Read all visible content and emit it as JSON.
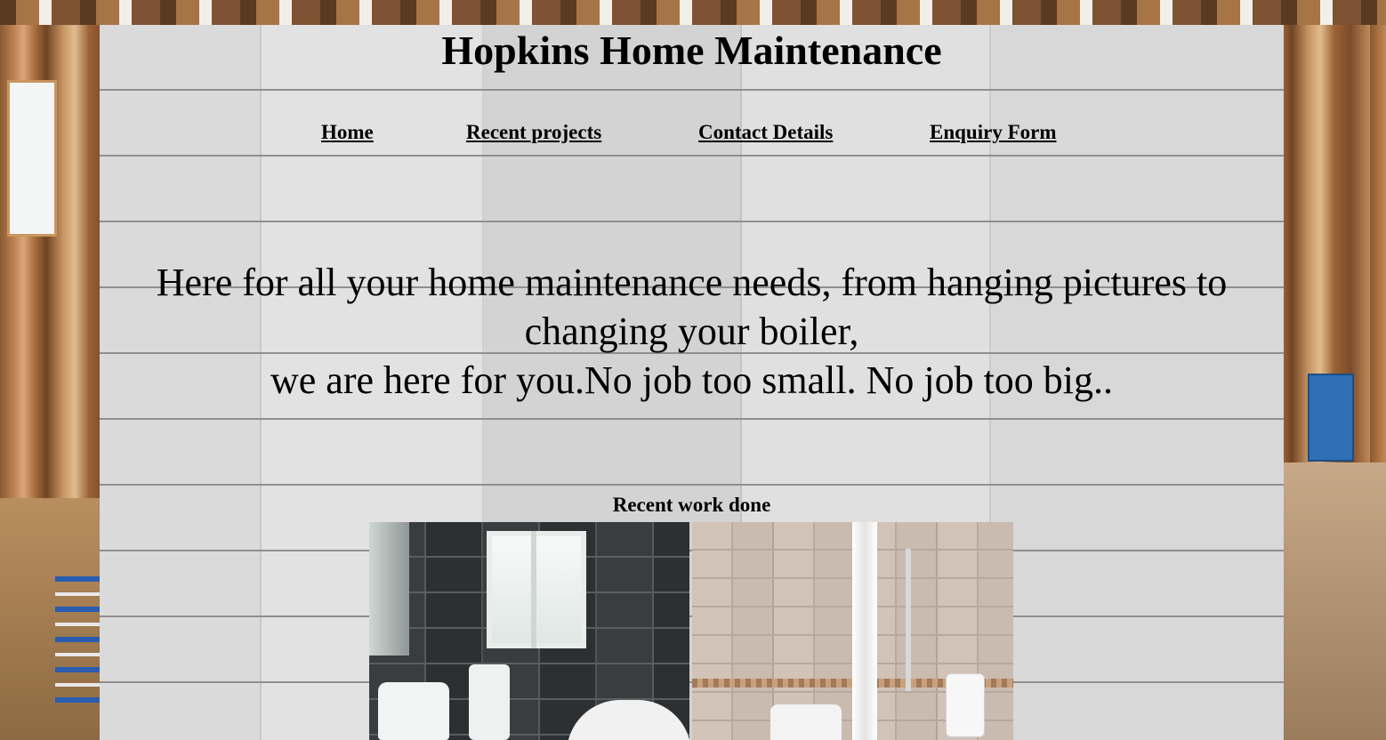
{
  "site": {
    "title": "Hopkins Home Maintenance"
  },
  "nav": {
    "items": [
      {
        "label": "Home"
      },
      {
        "label": "Recent projects"
      },
      {
        "label": "Contact Details"
      },
      {
        "label": "Enquiry Form"
      }
    ]
  },
  "hero": {
    "line1": "Here for all your home maintenance needs, from hanging pictures to",
    "line2": "changing your boiler,",
    "line3": "we are here for you.No job too small. No job too big.."
  },
  "recent": {
    "heading": "Recent work done",
    "photos": [
      {
        "subject": "dark-tiled-bathroom"
      },
      {
        "subject": "shower-room"
      }
    ]
  },
  "colors": {
    "text": "#000000",
    "panel": "#d6d6d6"
  }
}
